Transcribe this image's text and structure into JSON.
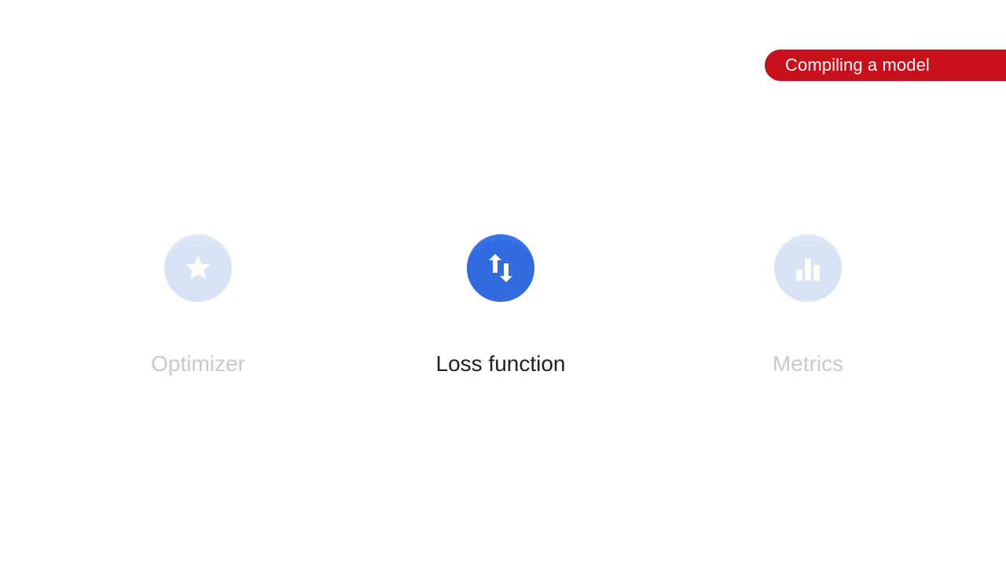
{
  "header": {
    "tag_label": "Compiling a model"
  },
  "steps": [
    {
      "label": "Optimizer",
      "icon": "star-icon",
      "state": "inactive"
    },
    {
      "label": "Loss function",
      "icon": "swap-vertical-icon",
      "state": "active"
    },
    {
      "label": "Metrics",
      "icon": "bar-chart-icon",
      "state": "inactive"
    }
  ],
  "colors": {
    "tag_background": "#c8101c",
    "active_circle": "#3672e8",
    "active_shade": "#2a5fcf",
    "inactive_circle": "#dde7f8",
    "inactive_shade": "#cfdcf3",
    "active_text": "#202124",
    "inactive_text": "#c7c9cc",
    "icon_white": "#ffffff"
  }
}
